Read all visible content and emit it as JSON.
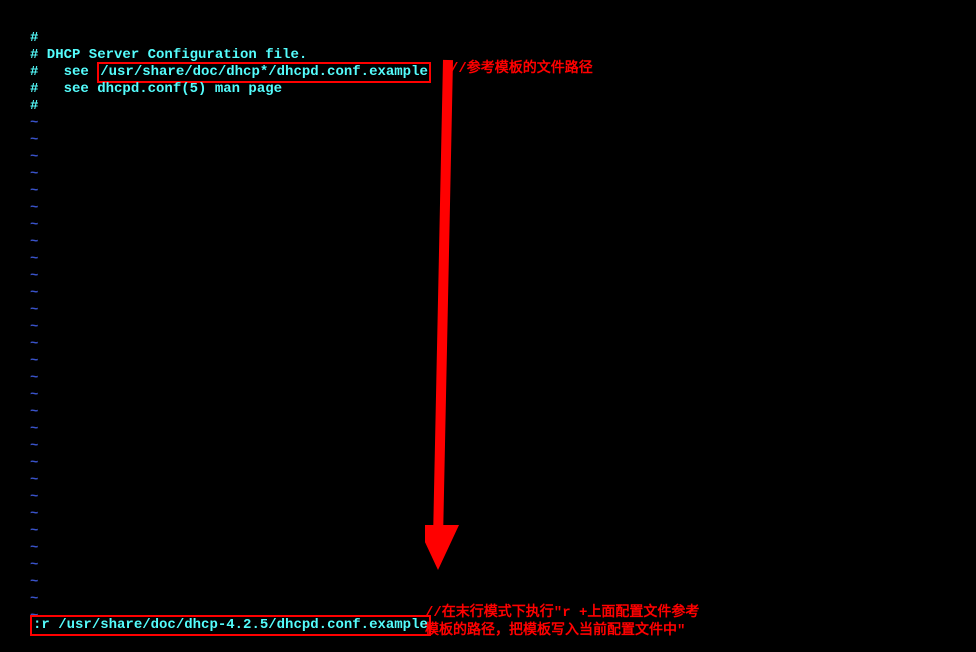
{
  "terminal": {
    "lines": [
      "#",
      "# DHCP Server Configuration file.",
      "#   see ",
      "#   see dhcpd.conf(5) man page",
      "#"
    ],
    "highlighted_path": "/usr/share/doc/dhcp*/dhcpd.conf.example",
    "tilde_count": 30
  },
  "command": {
    "prefix": ":r ",
    "path": "/usr/share/doc/dhcp-4.2.5/dhcpd.conf.example"
  },
  "annotations": {
    "top": "//参考模板的文件路径",
    "bottom_line1": "//在末行模式下执行\"r  +上面配置文件参考",
    "bottom_line2": "模板的路径，把模板写入当前配置文件中\""
  }
}
